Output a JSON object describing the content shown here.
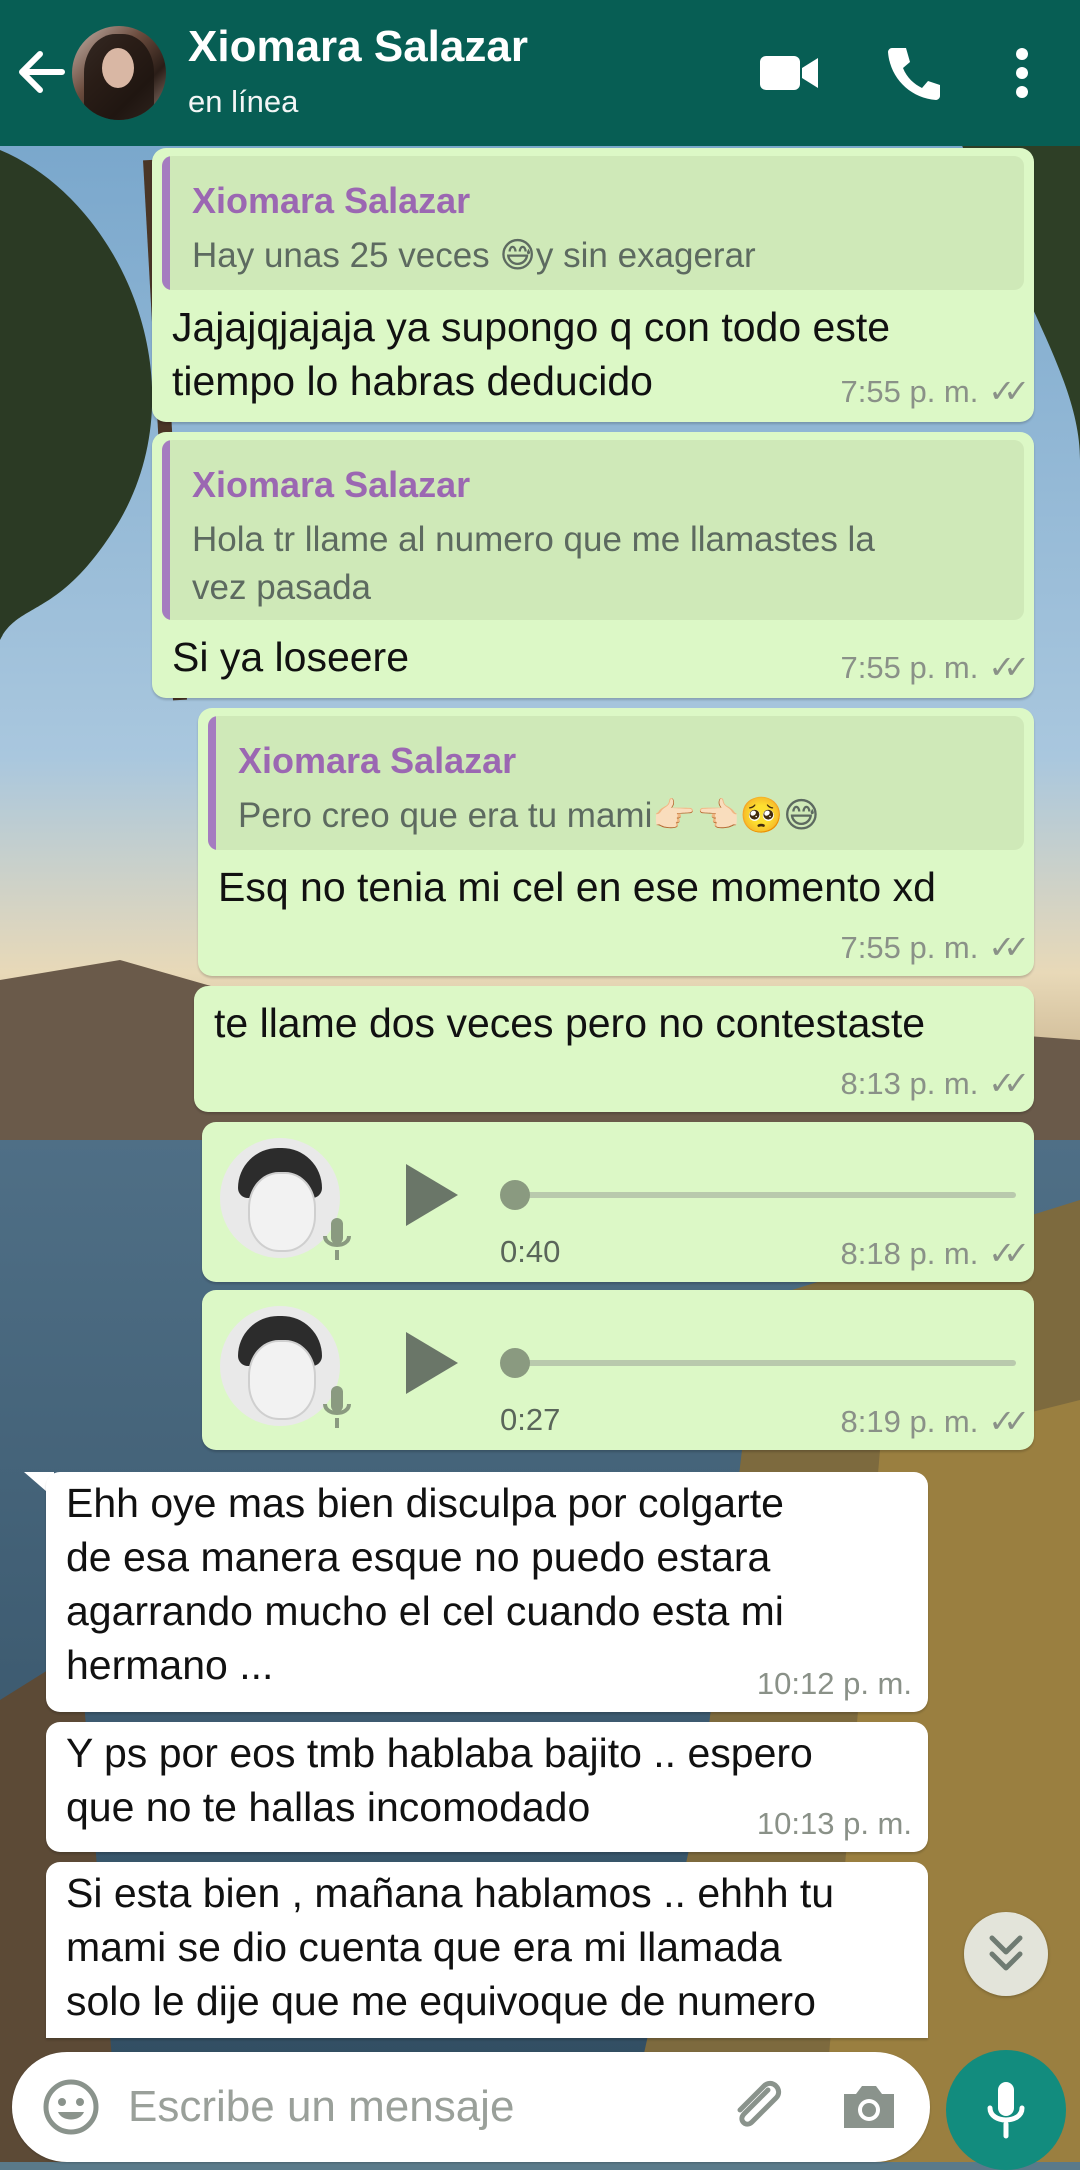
{
  "header": {
    "contact_name": "Xiomara Salazar",
    "status": "en línea",
    "icons": [
      "back-arrow-icon",
      "video-call-icon",
      "phone-icon",
      "more-options-icon"
    ]
  },
  "messages": [
    {
      "direction": "outgoing",
      "quote_name": "Xiomara Salazar",
      "quote_text": "Hay unas 25 veces 😅y sin exagerar",
      "text_lines": [
        "Jajajqjajaja ya supongo q con todo este",
        "tiempo lo habras deducido"
      ],
      "time": "7:55 p. m.",
      "ticks": "✓✓"
    },
    {
      "direction": "outgoing",
      "quote_name": "Xiomara Salazar",
      "quote_text_lines": [
        "Hola tr llame al numero que me llamastes la",
        "vez pasada"
      ],
      "text": "Si ya loseere",
      "time": "7:55 p. m.",
      "ticks": "✓✓"
    },
    {
      "direction": "outgoing",
      "quote_name": "Xiomara Salazar",
      "quote_text": "Pero creo que era tu mami👉🏻👈🏻🥺😅",
      "text": "Esq no tenia mi cel en ese momento xd",
      "time": "7:55 p. m.",
      "ticks": "✓✓"
    },
    {
      "direction": "outgoing",
      "text": "te llame dos veces pero no contestaste",
      "time": "8:13 p. m.",
      "ticks": "✓✓"
    },
    {
      "direction": "outgoing",
      "type": "audio",
      "duration": "0:40",
      "time": "8:18 p. m.",
      "ticks": "✓✓",
      "progress": 0
    },
    {
      "direction": "outgoing",
      "type": "audio",
      "duration": "0:27",
      "time": "8:19 p. m.",
      "ticks": "✓✓",
      "progress": 0
    },
    {
      "direction": "incoming",
      "text_lines": [
        "Ehh oye mas bien disculpa por colgarte",
        "de esa manera esque no puedo estara",
        "agarrando mucho el cel cuando esta mi",
        "hermano ..."
      ],
      "time": "10:12 p. m."
    },
    {
      "direction": "incoming",
      "text_lines": [
        "Y ps por eos tmb hablaba bajito .. espero",
        "que no te hallas incomodado"
      ],
      "time": "10:13 p. m."
    },
    {
      "direction": "incoming",
      "text_lines": [
        "Si esta bien , mañana hablamos .. ehhh tu",
        "mami se dio cuenta que era mi llamada",
        "solo le dije que me equivoque de numero"
      ]
    }
  ],
  "composer": {
    "placeholder": "Escribe un mensaje",
    "icons": [
      "emoji-icon",
      "attach-icon",
      "camera-icon",
      "mic-icon",
      "scroll-down-icon"
    ]
  },
  "colors": {
    "header": "#075e54",
    "outgoing_bubble": "#dcf8c6",
    "incoming_bubble": "#ffffff",
    "quote_name": "#9b67b2",
    "mic_button": "#128c7e"
  }
}
